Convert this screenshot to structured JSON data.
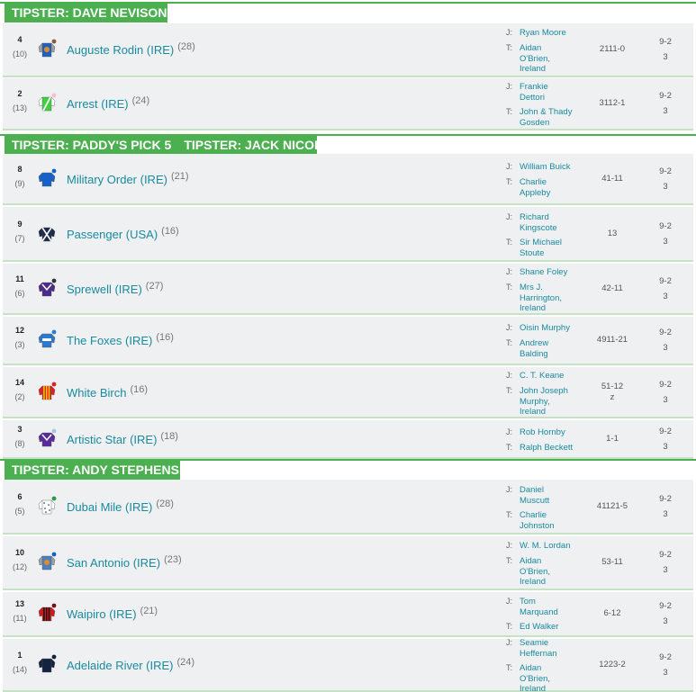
{
  "sections": [
    {
      "headers": [
        "TIPSTER: DAVE NEVISON"
      ],
      "runners": [
        {
          "num": "4",
          "draw": "(10)",
          "name": "Auguste Rodin (IRE)",
          "age": "(28)",
          "jockey": [
            "Ryan Moore"
          ],
          "trainer": [
            "Aidan",
            "O'Brien,",
            "Ireland"
          ],
          "form": "2111-0",
          "odds_top": "9-2",
          "odds_bottom": "3",
          "silk": "silk-royal-blue-orange-dot"
        },
        {
          "num": "2",
          "draw": "(13)",
          "name": "Arrest (IRE)",
          "age": "(24)",
          "jockey": [
            "Frankie",
            "Dettori"
          ],
          "trainer": [
            "John & Thady",
            "Gosden"
          ],
          "form": "3112-1",
          "odds_top": "9-2",
          "odds_bottom": "3",
          "silk": "silk-green-white-pink-cap"
        }
      ]
    },
    {
      "headers": [
        "TIPSTER: PADDY'S PICK 5",
        "TIPSTER: JACK NICOL"
      ],
      "runners": [
        {
          "num": "8",
          "draw": "(9)",
          "name": "Military Order (IRE)",
          "age": "(21)",
          "jockey": [
            "William Buick"
          ],
          "trainer": [
            "Charlie",
            "Appleby"
          ],
          "form": "41-11",
          "odds_top": "9-2",
          "odds_bottom": "3",
          "silk": "silk-royal-blue"
        },
        {
          "num": "9",
          "draw": "(7)",
          "name": "Passenger (USA)",
          "age": "(16)",
          "jockey": [
            "Richard",
            "Kingscote"
          ],
          "trainer": [
            "Sir Michael",
            "Stoute"
          ],
          "form": "13",
          "odds_top": "9-2",
          "odds_bottom": "3",
          "silk": "silk-navy-white-cross"
        },
        {
          "num": "11",
          "draw": "(6)",
          "name": "Sprewell (IRE)",
          "age": "(27)",
          "jockey": [
            "Shane Foley"
          ],
          "trainer": [
            "Mrs J.",
            "Harrington,",
            "Ireland"
          ],
          "form": "42-11",
          "odds_top": "9-2",
          "odds_bottom": "3",
          "silk": "silk-purple-white-chevron"
        },
        {
          "num": "12",
          "draw": "(3)",
          "name": "The Foxes (IRE)",
          "age": "(16)",
          "jockey": [
            "Oisin Murphy"
          ],
          "trainer": [
            "Andrew",
            "Balding"
          ],
          "form": "4911-21",
          "odds_top": "9-2",
          "odds_bottom": "3",
          "silk": "silk-blue-white-hoop"
        },
        {
          "num": "14",
          "draw": "(2)",
          "name": "White Birch",
          "age": "(16)",
          "jockey": [
            "C. T. Keane"
          ],
          "trainer": [
            "John Joseph",
            "Murphy,",
            "Ireland"
          ],
          "form": "51-12\nz",
          "odds_top": "9-2",
          "odds_bottom": "3",
          "silk": "silk-red-yellow-stripes"
        },
        {
          "num": "3",
          "draw": "(8)",
          "name": "Artistic Star (IRE)",
          "age": "(18)",
          "jockey": [
            "Rob Hornby"
          ],
          "trainer": [
            "Ralph Beckett"
          ],
          "form": "1-1",
          "odds_top": "9-2",
          "odds_bottom": "3",
          "silk": "silk-purple-white-chevron-lightblue-cap"
        }
      ]
    },
    {
      "headers": [
        "TIPSTER: ANDY STEPHENS"
      ],
      "runners": [
        {
          "num": "6",
          "draw": "(5)",
          "name": "Dubai Mile (IRE)",
          "age": "(28)",
          "jockey": [
            "Daniel",
            "Muscutt"
          ],
          "trainer": [
            "Charlie",
            "Johnston"
          ],
          "form": "41121-5",
          "odds_top": "9-2",
          "odds_bottom": "3",
          "silk": "silk-white-black-dots"
        },
        {
          "num": "10",
          "draw": "(12)",
          "name": "San Antonio (IRE)",
          "age": "(23)",
          "jockey": [
            "W. M. Lordan"
          ],
          "trainer": [
            "Aidan",
            "O'Brien,",
            "Ireland"
          ],
          "form": "53-11",
          "odds_top": "9-2",
          "odds_bottom": "3",
          "silk": "silk-royal-blue-orange-dot-blue-cap"
        },
        {
          "num": "13",
          "draw": "(11)",
          "name": "Waipiro (IRE)",
          "age": "(21)",
          "jockey": [
            "Tom",
            "Marquand"
          ],
          "trainer": [
            "Ed Walker"
          ],
          "form": "6-12",
          "odds_top": "9-2",
          "odds_bottom": "3",
          "silk": "silk-red-black-stripes"
        },
        {
          "num": "1",
          "draw": "(14)",
          "name": "Adelaide River (IRE)",
          "age": "(24)",
          "jockey": [
            "Seamie",
            "Heffernan"
          ],
          "trainer": [
            "Aidan",
            "O'Brien,",
            "Ireland"
          ],
          "form": "1223-2",
          "odds_top": "9-2",
          "odds_bottom": "3",
          "silk": "silk-navy"
        }
      ]
    }
  ],
  "labels": {
    "jockey": "J:",
    "trainer": "T:"
  },
  "colors": {
    "accent": "#4caf50",
    "link": "#1a8a9e",
    "row_bg": "#eef0f2"
  }
}
